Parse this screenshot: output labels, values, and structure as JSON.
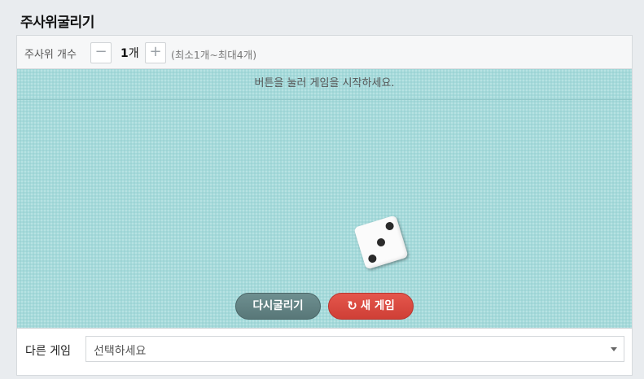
{
  "page_title": "주사위굴리기",
  "toolbar": {
    "count_label": "주사위 개수",
    "minus_symbol": "−",
    "plus_symbol": "+",
    "count_number": "1",
    "count_unit": "개",
    "count_range": "(최소1개~최대4개)"
  },
  "stage": {
    "message": "버튼을 눌러 게임을 시작하세요.",
    "dice": [
      3
    ],
    "background_color": "#a5dadb"
  },
  "buttons": {
    "reroll_label": "다시굴리기",
    "new_game_label": "새 게임",
    "new_game_icon": "refresh-icon",
    "reroll_color": "#5f7f80",
    "new_game_color": "#d9463d"
  },
  "footer": {
    "label": "다른 게임",
    "select_value": "선택하세요"
  }
}
